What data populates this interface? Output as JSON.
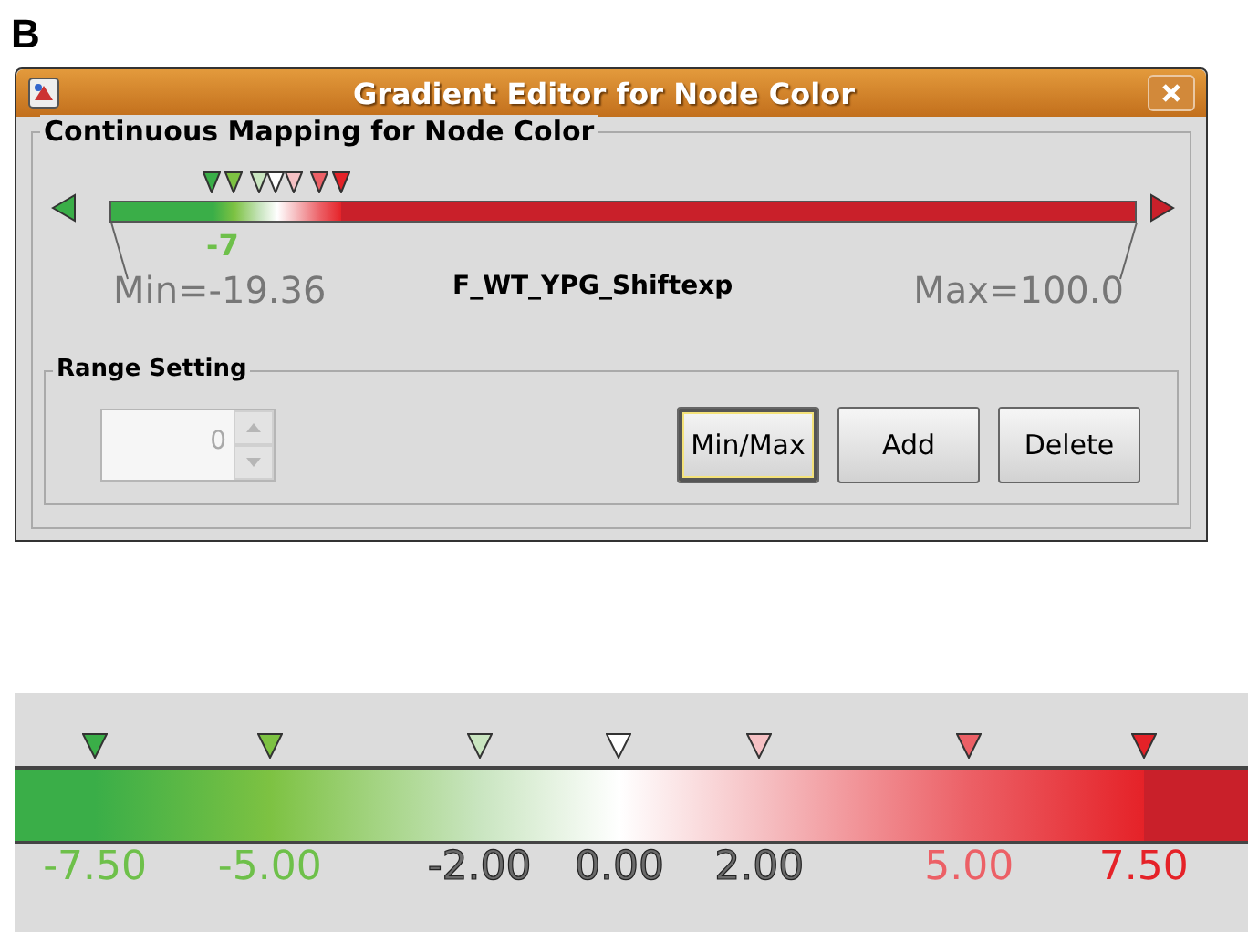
{
  "figure_label": "B",
  "window": {
    "title": "Gradient Editor for Node Color"
  },
  "mapping": {
    "title": "Continuous Mapping for Node Color",
    "attribute": "F_WT_YPG_Shiftexp",
    "min_label": "Min=-19.36",
    "max_label": "Max=100.0",
    "below": {
      "color": "#3aae48"
    },
    "above": {
      "color": "#c9202a"
    },
    "stops": [
      {
        "color": "#3aae48"
      },
      {
        "color": "#7dc242"
      },
      {
        "color": "#c9e5c0"
      },
      {
        "color": "#ffffff"
      },
      {
        "color": "#f6c1c4"
      },
      {
        "color": "#ec6066"
      },
      {
        "color": "#e52228"
      }
    ],
    "label_fragment": "-7"
  },
  "range_setting": {
    "title": "Range Setting",
    "value": "0",
    "disabled": true,
    "buttons": [
      {
        "label": "Min/Max",
        "focused": true
      },
      {
        "label": "Add",
        "focused": false
      },
      {
        "label": "Delete",
        "focused": false
      }
    ]
  },
  "detail_strip": {
    "stops": [
      {
        "label": "-7.50",
        "color": "#3aae48"
      },
      {
        "label": "-5.00",
        "color": "#7dc242"
      },
      {
        "label": "-2.00",
        "color": "#c9e5c0"
      },
      {
        "label": "0.00",
        "color": "#ffffff"
      },
      {
        "label": "2.00",
        "color": "#f6c1c4"
      },
      {
        "label": "5.00",
        "color": "#ec6066"
      },
      {
        "label": "7.50",
        "color": "#e52228"
      }
    ]
  }
}
